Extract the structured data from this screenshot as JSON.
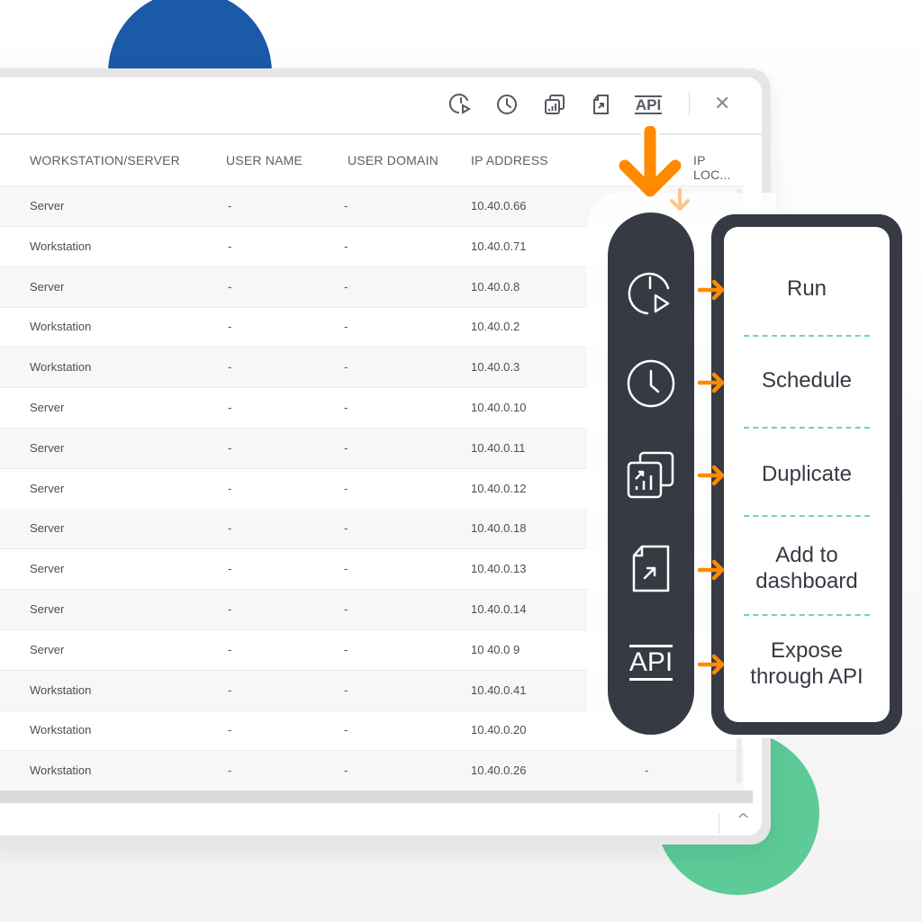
{
  "toolbar": {
    "icons": [
      {
        "name": "run-icon"
      },
      {
        "name": "schedule-icon"
      },
      {
        "name": "duplicate-icon"
      },
      {
        "name": "add-to-dashboard-icon"
      },
      {
        "name": "api-icon",
        "label": "API"
      }
    ],
    "close_label": "✕"
  },
  "table": {
    "columns": [
      "WORKSTATION/SERVER",
      "USER NAME",
      "USER DOMAIN",
      "IP ADDRESS",
      "IP LOC..."
    ],
    "rows": [
      {
        "type": "Server",
        "user": "-",
        "domain": "-",
        "ip": "10.40.0.66",
        "loc": ""
      },
      {
        "type": "Workstation",
        "user": "-",
        "domain": "-",
        "ip": "10.40.0.71",
        "loc": ""
      },
      {
        "type": "Server",
        "user": "-",
        "domain": "-",
        "ip": "10.40.0.8",
        "loc": ""
      },
      {
        "type": "Workstation",
        "user": "-",
        "domain": "-",
        "ip": "10.40.0.2",
        "loc": ""
      },
      {
        "type": "Workstation",
        "user": "-",
        "domain": "-",
        "ip": "10.40.0.3",
        "loc": ""
      },
      {
        "type": "Server",
        "user": "-",
        "domain": "-",
        "ip": "10.40.0.10",
        "loc": ""
      },
      {
        "type": "Server",
        "user": "-",
        "domain": "-",
        "ip": "10.40.0.11",
        "loc": ""
      },
      {
        "type": "Server",
        "user": "-",
        "domain": "-",
        "ip": "10.40.0.12",
        "loc": ""
      },
      {
        "type": "Server",
        "user": "-",
        "domain": "-",
        "ip": "10.40.0.18",
        "loc": ""
      },
      {
        "type": "Server",
        "user": "-",
        "domain": "-",
        "ip": "10.40.0.13",
        "loc": ""
      },
      {
        "type": "Server",
        "user": "-",
        "domain": "-",
        "ip": "10.40.0.14",
        "loc": ""
      },
      {
        "type": "Server",
        "user": "-",
        "domain": "-",
        "ip": "10 40.0 9",
        "loc": ""
      },
      {
        "type": "Workstation",
        "user": "-",
        "domain": "-",
        "ip": "10.40.0.41",
        "loc": ""
      },
      {
        "type": "Workstation",
        "user": "-",
        "domain": "-",
        "ip": "10.40.0.20",
        "loc": ""
      },
      {
        "type": "Workstation",
        "user": "-",
        "domain": "-",
        "ip": "10.40.0.26",
        "loc": "-"
      }
    ]
  },
  "footer": {
    "collapse_label": "^"
  },
  "callout": {
    "actions": [
      {
        "icon": "run-icon",
        "label": "Run"
      },
      {
        "icon": "schedule-icon",
        "label": "Schedule"
      },
      {
        "icon": "duplicate-icon",
        "label": "Duplicate"
      },
      {
        "icon": "add-to-dashboard-icon",
        "label": "Add to dashboard"
      },
      {
        "icon": "api-icon",
        "icon_text": "API",
        "label": "Expose through API"
      }
    ]
  },
  "colors": {
    "accent_orange": "#ff8a00",
    "dark": "#363a43",
    "green": "#5ccb98",
    "blue": "#1a5aa6",
    "divider_green": "#6fd6a6"
  }
}
